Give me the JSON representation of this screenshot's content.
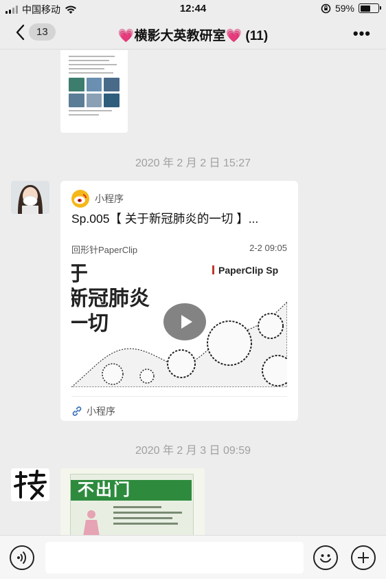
{
  "status_bar": {
    "carrier": "中国移动",
    "time": "12:44",
    "battery_percent": "59%",
    "battery_level": 0.59
  },
  "nav": {
    "unread_count": "13",
    "title": "💗横影大英教研室💗 (11)",
    "more_icon": "more-dots-icon"
  },
  "messages": {
    "timestamp_1": "2020 年 2 月 2 日 15:27",
    "card": {
      "app_label": "小程序",
      "title": "Sp.005【 关于新冠肺炎的一切 】...",
      "author": "回形针PaperClip",
      "date": "2-2 09:05",
      "cover_brand": "PaperClip Sp",
      "cover_text": "于\n新冠肺炎\n一切",
      "footer_label": "小程序"
    },
    "timestamp_2": "2020 年 2 月 3 日 09:59",
    "image_caption": "不出门"
  },
  "input_bar": {
    "placeholder": "",
    "voice_icon": "voice-icon",
    "emoji_icon": "emoji-icon",
    "plus_icon": "plus-icon"
  },
  "colors": {
    "background": "#ededed",
    "bubble": "#ffffff",
    "timestamp": "#a0a0a0",
    "weibo_yellow": "#f5b81a",
    "med_green": "#2e8b3e"
  }
}
